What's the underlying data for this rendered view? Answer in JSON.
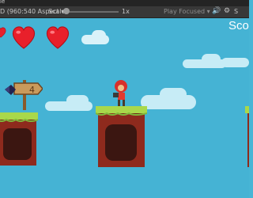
{
  "window": {
    "title_fragment": "le"
  },
  "toolbar": {
    "aspect_label": "D (960:540 Aspect",
    "aspect_caret": "▾",
    "scale_label": "Scale",
    "scale_value": "1x",
    "scale_level": 0.0,
    "play_mode_label": "Play Focused",
    "play_mode_caret": "▾",
    "audio_icon": "speaker-icon",
    "gizmo_icon": "gizmo-icon",
    "stats_label": "S"
  },
  "hud": {
    "score_label": "Sco",
    "lives": 3,
    "heart_color": "#e8202b"
  },
  "scene": {
    "sign_icon": "number-sign-icon",
    "player_icon": "player-character-icon",
    "grass_color": "#a9d84a",
    "rock_color": "#8e2a1d",
    "sky_color": "#45b3d4"
  }
}
